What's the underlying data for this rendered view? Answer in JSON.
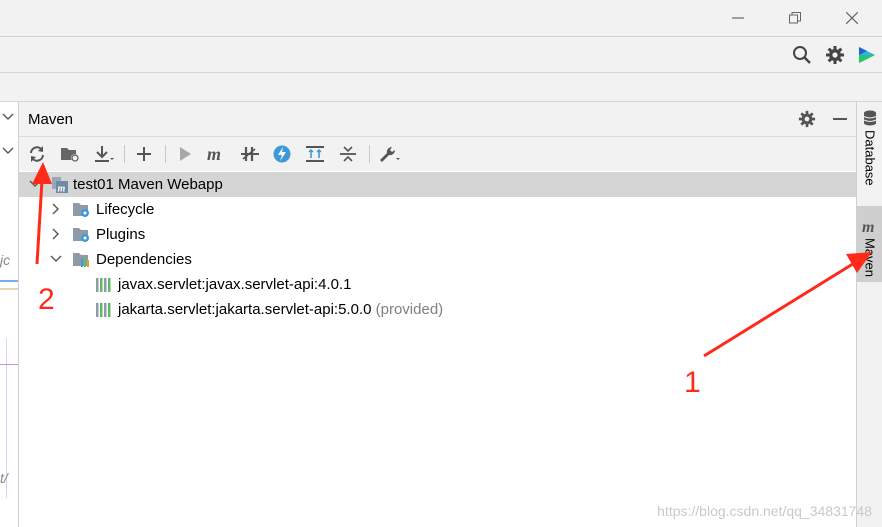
{
  "maven": {
    "title": "Maven",
    "tree": {
      "root": "test01 Maven Webapp",
      "lifecycle": "Lifecycle",
      "plugins": "Plugins",
      "dependencies": "Dependencies",
      "dep1": "javax.servlet:javax.servlet-api:4.0.1",
      "dep2": "jakarta.servlet:jakarta.servlet-api:5.0.0",
      "dep2_scope": "(provided)"
    }
  },
  "right_strip": {
    "database_label": "Database",
    "maven_label": "Maven"
  },
  "annotations": {
    "label_1": "1",
    "label_2": "2"
  },
  "left_strip": {
    "fragment_1": "jc",
    "fragment_2": "t/"
  },
  "watermark": "https://blog.csdn.net/qq_34831748",
  "colors": {
    "accent_red": "#ff2a1a",
    "selection": "#d5d5d5",
    "maven_blue": "#3d8fd1"
  }
}
